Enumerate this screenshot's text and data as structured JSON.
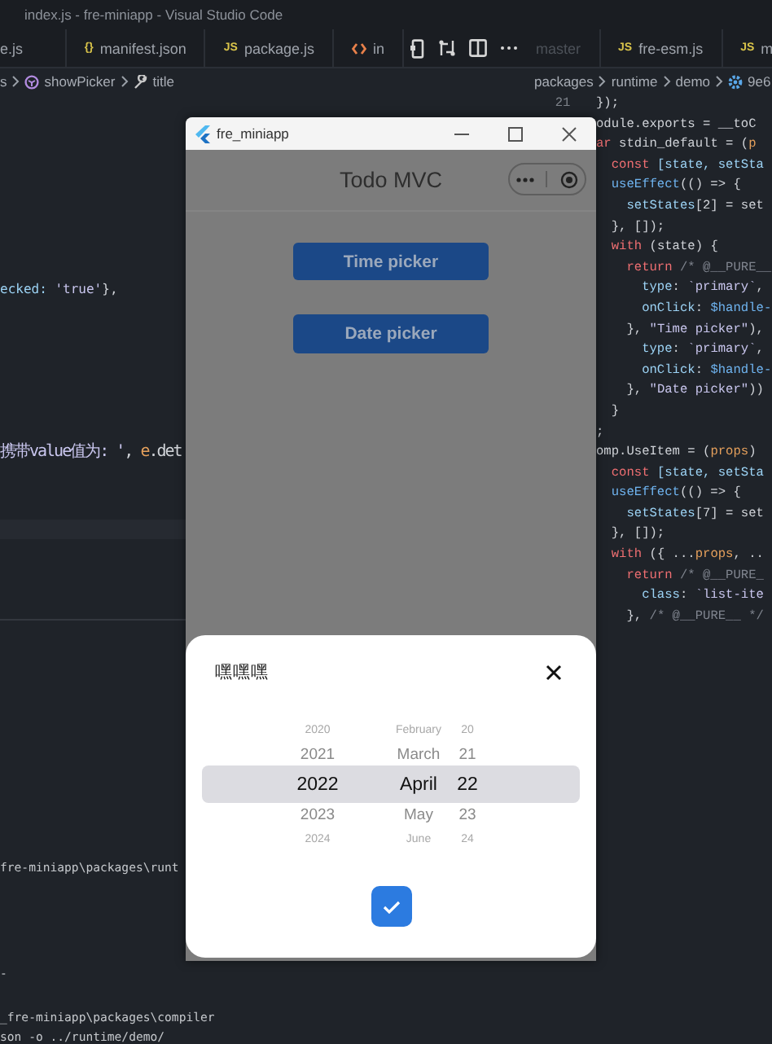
{
  "window": {
    "title": "index.js - fre-miniapp - Visual Studio Code"
  },
  "tabs_left": [
    {
      "label": "e.js",
      "kind": "plain"
    },
    {
      "label": "manifest.json",
      "kind": "json",
      "badge": "{}"
    },
    {
      "label": "package.js",
      "kind": "js",
      "badge": "JS"
    },
    {
      "label": "in",
      "kind": "html"
    }
  ],
  "tabs_right": [
    {
      "label": "master",
      "kind": "dim"
    },
    {
      "label": "fre-esm.js",
      "kind": "js",
      "badge": "JS"
    },
    {
      "label": "m",
      "kind": "js",
      "badge": "JS"
    }
  ],
  "breadcrumb_left": [
    {
      "label": "s",
      "kind": "plain"
    },
    {
      "label": "showPicker",
      "kind": "method"
    },
    {
      "label": "title",
      "kind": "property"
    }
  ],
  "breadcrumb_right": [
    {
      "label": "packages",
      "kind": "plain"
    },
    {
      "label": "runtime",
      "kind": "plain"
    },
    {
      "label": "demo",
      "kind": "plain"
    },
    {
      "label": "9e6",
      "kind": "gear"
    }
  ],
  "editor_left": {
    "lines": [
      {
        "tokens": [
          {
            "text": "ecked: ",
            "kind": "id"
          },
          {
            "text": "'true'",
            "kind": "str"
          },
          {
            "text": "},",
            "kind": "pl"
          }
        ]
      },
      {
        "tokens": [
          {
            "text": "携带value值为: '",
            "kind": "str"
          },
          {
            "text": ", ",
            "kind": "pl"
          },
          {
            "text": "e",
            "kind": "par"
          },
          {
            "text": ".det",
            "kind": "pl"
          }
        ]
      }
    ]
  },
  "editor_right": {
    "lines": [
      {
        "line_number": "21",
        "tokens": [
          {
            "text": "});",
            "kind": "pl"
          }
        ]
      },
      {
        "tokens": [
          {
            "text": "odule.exports = __toC",
            "kind": "pl"
          }
        ]
      },
      {
        "tokens": [
          {
            "text": "ar ",
            "kind": "kw"
          },
          {
            "text": "stdin_default = (",
            "kind": "pl"
          },
          {
            "text": "p",
            "kind": "par"
          }
        ]
      },
      {
        "tokens": [
          {
            "text": "  const ",
            "kind": "kw"
          },
          {
            "text": "[state, setSta",
            "kind": "id"
          }
        ]
      },
      {
        "tokens": [
          {
            "text": "  useEffect",
            "kind": "fn"
          },
          {
            "text": "(() => {",
            "kind": "pl"
          }
        ]
      },
      {
        "tokens": [
          {
            "text": "    setStates",
            "kind": "id"
          },
          {
            "text": "[2] = set",
            "kind": "pl"
          }
        ]
      },
      {
        "tokens": [
          {
            "text": "  }, []);",
            "kind": "pl"
          }
        ]
      },
      {
        "tokens": [
          {
            "text": "  with ",
            "kind": "kw"
          },
          {
            "text": "(state) {",
            "kind": "pl"
          }
        ]
      },
      {
        "tokens": [
          {
            "text": "    return ",
            "kind": "kw"
          },
          {
            "text": "/* @__PURE__",
            "kind": "cm"
          }
        ]
      },
      {
        "tokens": [
          {
            "text": "      type",
            "kind": "id"
          },
          {
            "text": ": ",
            "kind": "pl"
          },
          {
            "text": "`primary`",
            "kind": "str"
          },
          {
            "text": ",",
            "kind": "pl"
          }
        ]
      },
      {
        "tokens": [
          {
            "text": "      onClick",
            "kind": "id"
          },
          {
            "text": ": ",
            "kind": "pl"
          },
          {
            "text": "$handle-",
            "kind": "fn"
          }
        ]
      },
      {
        "tokens": [
          {
            "text": "    }, ",
            "kind": "pl"
          },
          {
            "text": "\"Time picker\"",
            "kind": "str"
          },
          {
            "text": "),",
            "kind": "pl"
          }
        ]
      },
      {
        "tokens": [
          {
            "text": "      type",
            "kind": "id"
          },
          {
            "text": ": ",
            "kind": "pl"
          },
          {
            "text": "`primary`",
            "kind": "str"
          },
          {
            "text": ",",
            "kind": "pl"
          }
        ]
      },
      {
        "tokens": [
          {
            "text": "      onClick",
            "kind": "id"
          },
          {
            "text": ": ",
            "kind": "pl"
          },
          {
            "text": "$handle-",
            "kind": "fn"
          }
        ]
      },
      {
        "tokens": [
          {
            "text": "    }, ",
            "kind": "pl"
          },
          {
            "text": "\"Date picker\"",
            "kind": "str"
          },
          {
            "text": "))",
            "kind": "pl"
          }
        ]
      },
      {
        "tokens": [
          {
            "text": "  }",
            "kind": "pl"
          }
        ]
      },
      {
        "tokens": [
          {
            "text": ";",
            "kind": "pl"
          }
        ]
      },
      {
        "tokens": [
          {
            "text": "omp.UseItem = (",
            "kind": "pl"
          },
          {
            "text": "props",
            "kind": "par"
          },
          {
            "text": ")",
            "kind": "pl"
          }
        ]
      },
      {
        "tokens": [
          {
            "text": "  const ",
            "kind": "kw"
          },
          {
            "text": "[state, setSta",
            "kind": "id"
          }
        ]
      },
      {
        "tokens": [
          {
            "text": "  useEffect",
            "kind": "fn"
          },
          {
            "text": "(() => {",
            "kind": "pl"
          }
        ]
      },
      {
        "tokens": [
          {
            "text": "    setStates",
            "kind": "id"
          },
          {
            "text": "[7] = set",
            "kind": "pl"
          }
        ]
      },
      {
        "tokens": [
          {
            "text": "  }, []);",
            "kind": "pl"
          }
        ]
      },
      {
        "tokens": [
          {
            "text": "  with ",
            "kind": "kw"
          },
          {
            "text": "({ ...",
            "kind": "pl"
          },
          {
            "text": "props",
            "kind": "par"
          },
          {
            "text": ", ..",
            "kind": "pl"
          }
        ]
      },
      {
        "tokens": [
          {
            "text": "    return ",
            "kind": "kw"
          },
          {
            "text": "/* @__PURE_",
            "kind": "cm"
          }
        ]
      },
      {
        "tokens": [
          {
            "text": "      class",
            "kind": "id"
          },
          {
            "text": ": ",
            "kind": "pl"
          },
          {
            "text": "`list-ite",
            "kind": "str"
          }
        ]
      },
      {
        "tokens": [
          {
            "text": "    }, ",
            "kind": "pl"
          },
          {
            "text": "/* @__PURE__ */",
            "kind": "cm"
          }
        ]
      }
    ]
  },
  "terminal": {
    "lines": [
      "fre-miniapp\\packages\\runt",
      "-",
      "_fre-miniapp\\packages\\compiler",
      "son -o ../runtime/demo/"
    ]
  },
  "app": {
    "title": "fre_miniapp",
    "header": "Todo MVC",
    "buttons": [
      "Time picker",
      "Date picker"
    ],
    "sheet": {
      "title": "嘿嘿嘿",
      "columns": [
        {
          "items": [
            {
              "label": "2020",
              "selected": false
            },
            {
              "label": "2021",
              "selected": false
            },
            {
              "label": "2022",
              "selected": true
            },
            {
              "label": "2023",
              "selected": false
            },
            {
              "label": "2024",
              "selected": false
            }
          ]
        },
        {
          "items": [
            {
              "label": "February",
              "selected": false
            },
            {
              "label": "March",
              "selected": false
            },
            {
              "label": "April",
              "selected": true
            },
            {
              "label": "May",
              "selected": false
            },
            {
              "label": "June",
              "selected": false
            }
          ]
        },
        {
          "items": [
            {
              "label": "20",
              "selected": false
            },
            {
              "label": "21",
              "selected": false
            },
            {
              "label": "22",
              "selected": true
            },
            {
              "label": "23",
              "selected": false
            },
            {
              "label": "24",
              "selected": false
            }
          ]
        }
      ]
    }
  }
}
